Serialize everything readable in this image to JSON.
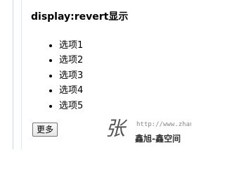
{
  "heading": "display:revert显示",
  "options": [
    "选项1",
    "选项2",
    "选项3",
    "选项4",
    "选项5"
  ],
  "more_button_label": "更多",
  "watermark": {
    "char": "张",
    "url": "http://www.zhan",
    "name": "鑫旭-鑫空间"
  }
}
